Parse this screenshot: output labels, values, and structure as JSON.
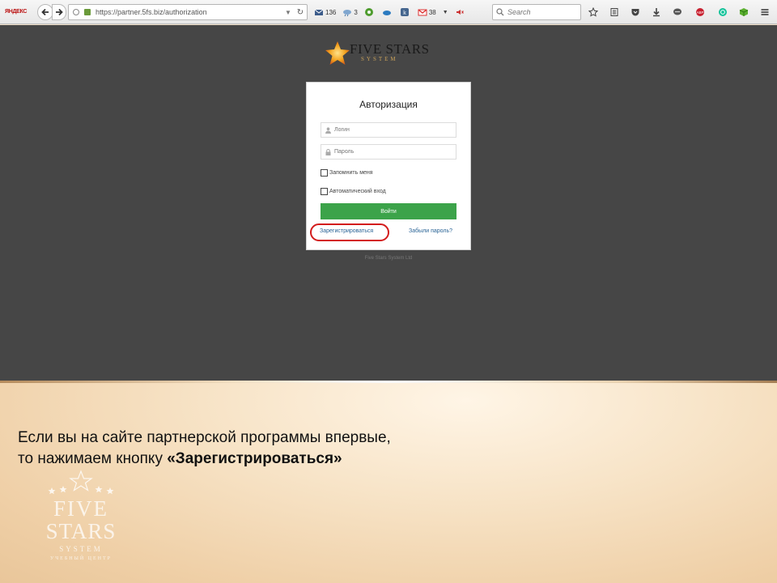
{
  "browser": {
    "brand_badge": "ЯНДЕКС",
    "url": "https://partner.5fs.biz/authorization",
    "search_placeholder": "Search",
    "extensions": [
      {
        "icon": "mail-icon",
        "count": "136"
      },
      {
        "icon": "weather-icon",
        "count": "3"
      },
      {
        "icon": "evernote-icon",
        "count": ""
      },
      {
        "icon": "cloud-icon",
        "count": ""
      },
      {
        "icon": "vk-icon",
        "count": ""
      },
      {
        "icon": "gmail-icon",
        "count": "38"
      }
    ]
  },
  "logo": {
    "title": "FIVE STARS",
    "subtitle": "SYSTEM"
  },
  "auth": {
    "title": "Авторизация",
    "login_placeholder": "Логин",
    "password_placeholder": "Пароль",
    "remember_label": "Запомнить меня",
    "auto_login_label": "Автоматический вход",
    "login_button": "Войти",
    "register_link": "Зарегистрироваться",
    "forgot_link": "Забыли пароль?"
  },
  "footer": "Five Stars System Ltd",
  "slide": {
    "line1": "Если вы на сайте партнерской программы впервые,",
    "line2_prefix": "то нажимаем кнопку ",
    "line2_bold": "«Зарегистрироваться»",
    "watermark": {
      "five": "FIVE",
      "stars": "STARS",
      "system": "SYSTEM",
      "center": "УЧЕБНЫЙ ЦЕНТР"
    }
  },
  "colors": {
    "page_bg": "#464646",
    "login_button": "#3ca34a",
    "highlight_ring": "#d31c1c",
    "link": "#2a6496"
  }
}
